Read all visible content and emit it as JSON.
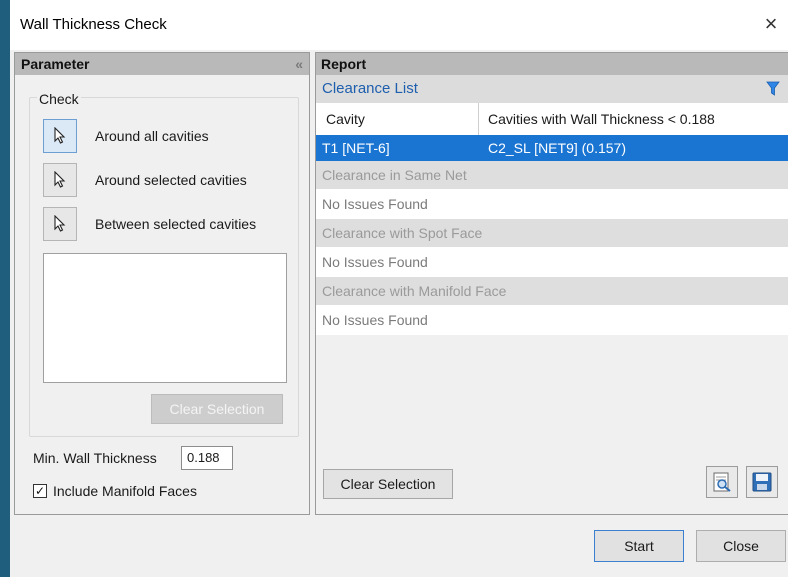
{
  "window": {
    "title": "Wall Thickness Check",
    "close_glyph": "×"
  },
  "parameter": {
    "header": "Parameter",
    "collapse_glyph": "«",
    "check_legend": "Check",
    "options": [
      {
        "label": "Around all cavities",
        "icon": "cursor-icon"
      },
      {
        "label": "Around selected cavities",
        "icon": "cursor-icon"
      },
      {
        "label": "Between selected cavities",
        "icon": "cursor-icon"
      }
    ],
    "clear_selection_label": "Clear Selection",
    "min_wall_label": "Min. Wall Thickness",
    "min_wall_value": "0.188",
    "include_manifold_label": "Include Manifold Faces",
    "include_manifold_checked": true,
    "checkmark": "✓"
  },
  "report": {
    "header": "Report",
    "clearance_list_label": "Clearance List",
    "columns": [
      "Cavity",
      "Cavities with Wall Thickness < 0.188"
    ],
    "selected_row": {
      "cavity": "T1 [NET-6]",
      "value": "C2_SL [NET9] (0.157)"
    },
    "sections": [
      {
        "title": "Clearance in Same Net",
        "result": "No Issues Found"
      },
      {
        "title": "Clearance with Spot Face",
        "result": "No Issues Found"
      },
      {
        "title": "Clearance with Manifold Face",
        "result": "No Issues Found"
      }
    ],
    "clear_selection_label": "Clear Selection",
    "accent_color": "#1a74d2"
  },
  "footer": {
    "start_label": "Start",
    "close_label": "Close"
  }
}
